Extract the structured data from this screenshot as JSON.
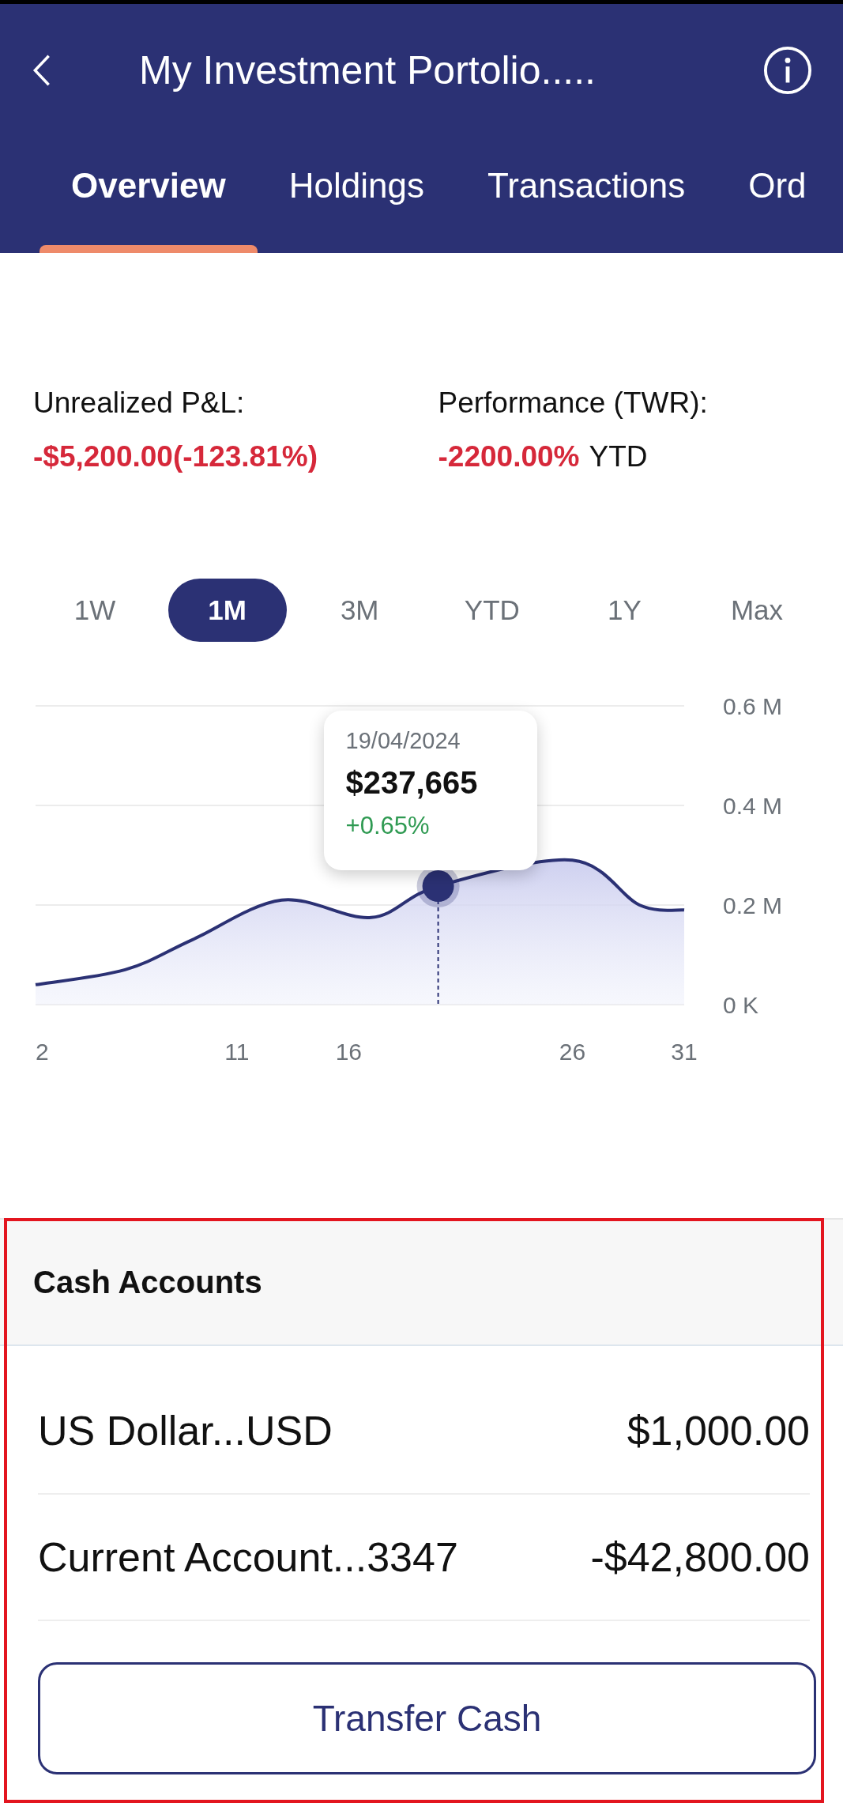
{
  "header": {
    "title": "My Investment Portolio....."
  },
  "tabs": [
    {
      "label": "Overview",
      "selected": true
    },
    {
      "label": "Holdings",
      "selected": false
    },
    {
      "label": "Transactions",
      "selected": false
    },
    {
      "label": "Ord",
      "selected": false
    }
  ],
  "stats": [
    {
      "label": "Unrealized P&L:",
      "value": "-$5,200.00(-123.81%)"
    },
    {
      "label": "Performance (TWR):",
      "value": "-2200.00%",
      "suffix": "YTD"
    }
  ],
  "ranges": [
    {
      "label": "1W",
      "selected": false
    },
    {
      "label": "1M",
      "selected": true
    },
    {
      "label": "3M",
      "selected": false
    },
    {
      "label": "YTD",
      "selected": false
    },
    {
      "label": "1Y",
      "selected": false
    },
    {
      "label": "Max",
      "selected": false
    }
  ],
  "chart_data": {
    "type": "area",
    "x": [
      2,
      6,
      9,
      13,
      17,
      20,
      26,
      29,
      31
    ],
    "series": [
      {
        "color": "#2b3174",
        "values": [
          0.04,
          0.07,
          0.13,
          0.21,
          0.175,
          0.238,
          0.29,
          0.2,
          0.19
        ]
      }
    ],
    "xlim": [
      2,
      31
    ],
    "ylim": [
      0,
      0.6
    ],
    "xticks": [
      2,
      11,
      16,
      26,
      31
    ],
    "yticks": [
      {
        "value": 0,
        "label": "0 K"
      },
      {
        "value": 0.2,
        "label": "0.2 M"
      },
      {
        "value": 0.4,
        "label": "0.4 M"
      },
      {
        "value": 0.6,
        "label": "0.6 M"
      }
    ],
    "annotations": [
      {
        "x": 20,
        "y": 0.238,
        "text": "$237,665"
      }
    ]
  },
  "tooltip": {
    "date": "19/04/2024",
    "change": "+0.65%"
  },
  "cash_accounts": {
    "title": "Cash Accounts",
    "rows": [
      {
        "name": "US Dollar...USD",
        "amount": "$1,000.00"
      },
      {
        "name": "Current Account...3347",
        "amount": "-$42,800.00"
      }
    ],
    "button": "Transfer Cash"
  }
}
